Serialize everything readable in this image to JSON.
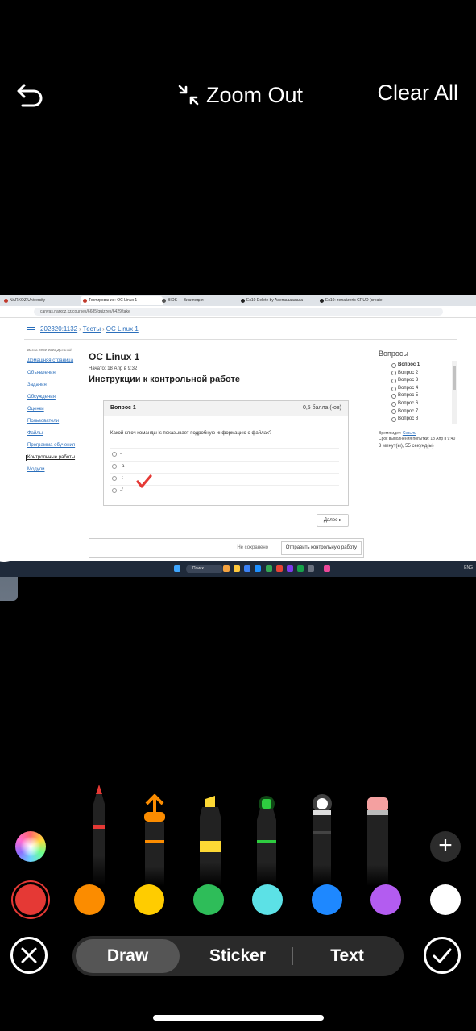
{
  "topbar": {
    "zoom_label": "Zoom Out",
    "clear_label": "Clear All"
  },
  "screenshot": {
    "tabs": [
      "NARXOZ University",
      "Тестирование: ОС Linux 1",
      "BIOS — Википедия",
      "Ex10 Delete by Asemaaaaaaaa",
      "Ex10: zenalizeric CRUD (create,"
    ],
    "url": "canvas.narxoz.kz/courses/6685/quizzes/6429/take",
    "breadcrumbs": [
      "202320:1132",
      "Тесты",
      "ОС Linux 1"
    ],
    "sidebar": {
      "term": "Весна 2022-2023 Дневной",
      "items": [
        "Домашняя страница",
        "Объявления",
        "Задания",
        "Обсуждения",
        "Оценки",
        "Пользователи",
        "Файлы",
        "Программа обучения",
        "Контрольные работы",
        "Модули"
      ]
    },
    "quiz_title": "ОС Linux 1",
    "started": "Начато: 18 Апр в 9:32",
    "instructions": "Инструкции к контрольной работе",
    "question": {
      "label": "Вопрос 1",
      "points": "0,5 балла (-ов)",
      "text": "Какой ключ команды ls показывает подробную информацию о файлах?",
      "options": [
        "-l",
        "-a",
        "-t",
        "-f"
      ]
    },
    "next_label": "Далее ▸",
    "not_saved": "Не сохранено",
    "submit_label": "Отправить контрольную работу",
    "questions_header": "Вопросы",
    "questions": [
      "Вопрос 1",
      "Вопрос 2",
      "Вопрос 3",
      "Вопрос 4",
      "Вопрос 5",
      "Вопрос 6",
      "Вопрос 7",
      "Вопрос 8"
    ],
    "timer_label": "Время идет:",
    "timer_hide": "Скрыть",
    "timer_deadline": "Срок выполнения попытки: 18 Апр в 9:40",
    "timer_value": "3 минут(ы), 55 секунд(ы)",
    "taskbar_search": "Поиск",
    "tray_lang": "ENG"
  },
  "tools": {
    "pens": [
      {
        "name": "pen",
        "color": "#e53935"
      },
      {
        "name": "marker",
        "color": "#fb8c00"
      },
      {
        "name": "highlighter",
        "color": "#fdd835"
      },
      {
        "name": "neon",
        "color": "#2ecc40"
      },
      {
        "name": "glow",
        "color": "#ffffff"
      },
      {
        "name": "eraser",
        "color": "#f4a0a0"
      }
    ],
    "colors": [
      "#e53935",
      "#fb8c00",
      "#ffcc00",
      "#2ebd59",
      "#5ce1e6",
      "#1e88ff",
      "#b35cf0",
      "#ffffff"
    ],
    "selected_color": "#e53935"
  },
  "modes": {
    "draw": "Draw",
    "sticker": "Sticker",
    "text": "Text",
    "active": "Draw"
  }
}
